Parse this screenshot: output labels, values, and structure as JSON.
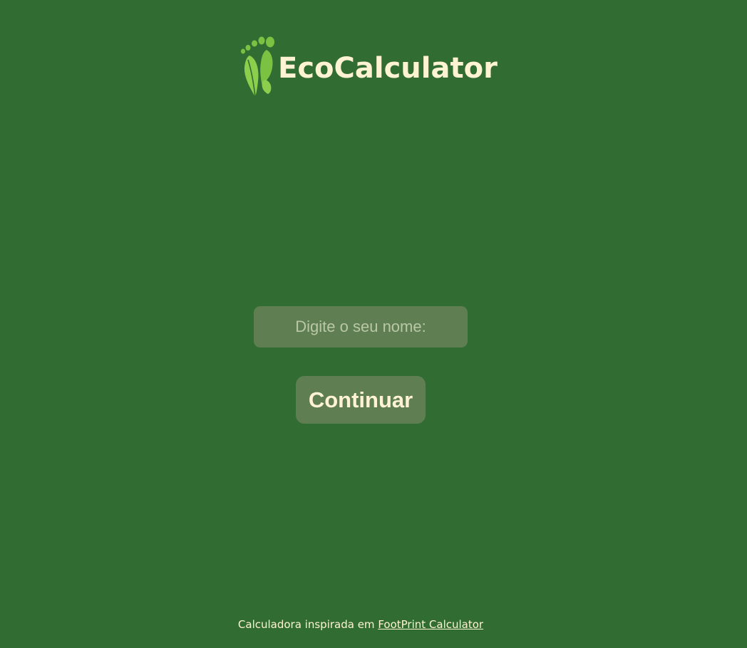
{
  "brand": {
    "name": "EcoCalculator",
    "logo_icon": "leaf-footprint-icon"
  },
  "form": {
    "name_placeholder": "Digite o seu nome:",
    "name_value": "",
    "continue_label": "Continuar"
  },
  "footer": {
    "text": "Calculadora inspirada em ",
    "link_text": "FootPrint Calculator"
  },
  "colors": {
    "background": "#316c33",
    "accent_text": "#fff3d4",
    "control_bg": "#5f7f52",
    "logo_green": "#7cc242"
  }
}
